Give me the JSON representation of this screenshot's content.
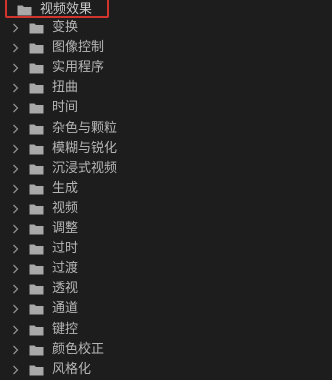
{
  "panel": {
    "root": {
      "label": "视频效果"
    },
    "items": [
      {
        "label": "变换"
      },
      {
        "label": "图像控制"
      },
      {
        "label": "实用程序"
      },
      {
        "label": "扭曲"
      },
      {
        "label": "时间"
      },
      {
        "label": "杂色与颗粒"
      },
      {
        "label": "模糊与锐化"
      },
      {
        "label": "沉浸式视频"
      },
      {
        "label": "生成"
      },
      {
        "label": "视频"
      },
      {
        "label": "调整"
      },
      {
        "label": "过时"
      },
      {
        "label": "过渡"
      },
      {
        "label": "透视"
      },
      {
        "label": "通道"
      },
      {
        "label": "键控"
      },
      {
        "label": "颜色校正"
      },
      {
        "label": "风格化"
      }
    ]
  },
  "icons": {
    "folder": "folder-icon",
    "chevron": "chevron-right-icon"
  },
  "colors": {
    "background": "#1d1d1d",
    "highlight_border": "#d0342c",
    "text": "#b6b6b6"
  }
}
